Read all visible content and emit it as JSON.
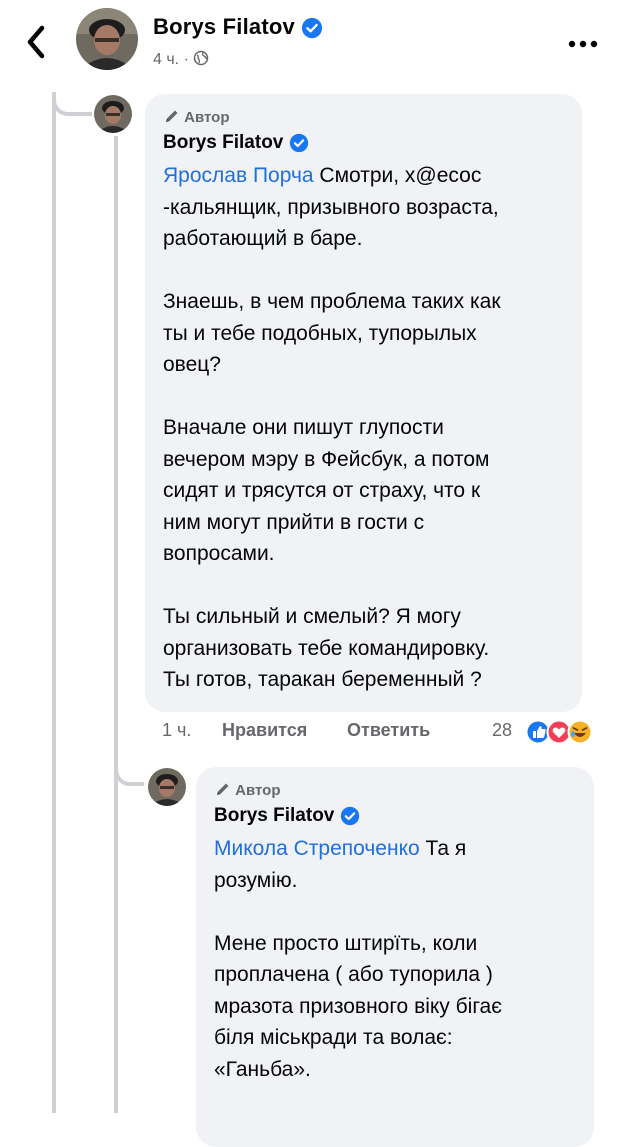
{
  "header": {
    "name": "Borys Filatov",
    "meta": "4 ч. ·"
  },
  "comment1": {
    "author_tag": "Автор",
    "name": "Borys Filatov",
    "mention": "Ярослав Порча",
    "text": " Смотри, х@есос\n-кальянщик, призывного возраста,\nработающий в баре.\n\nЗнаешь, в чем проблема таких как\nты и тебе подобных, тупорылых\nовец?\n\nВначале они пишут глупости\nвечером мэру в Фейсбук, а потом\nсидят и трясутся от страху, что к\nним могут прийти в гости с\nвопросами.\n\nТы сильный и смелый? Я могу\nорганизовать тебе командировку.\nТы готов, таракан беременный ?",
    "time": "1 ч.",
    "like_label": "Нравится",
    "reply_label": "Ответить",
    "reaction_count": "28"
  },
  "comment2": {
    "author_tag": "Автор",
    "name": "Borys Filatov",
    "mention": "Микола Стрепоченко",
    "text_line1": " Та я",
    "text": "розумію.\n\nМене просто штирїть, коли\nпроплачена ( або тупорила )\nмразота призовного віку бігає\nбіля міськради та волає:\n«Ганьба»."
  },
  "colors": {
    "mention": "#216fdb",
    "verified": "#1877f2",
    "bubble": "#f0f2f5",
    "muted": "#65676b"
  }
}
